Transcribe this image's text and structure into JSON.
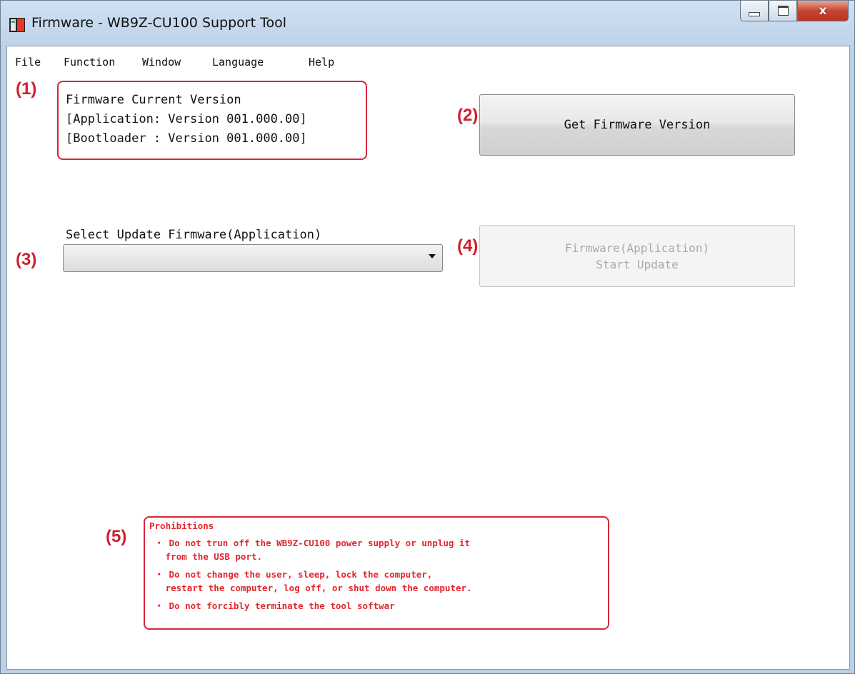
{
  "window": {
    "title": "Firmware - WB9Z-CU100 Support Tool",
    "close_glyph": "x",
    "colors": {
      "callout": "#d0202f",
      "prohibition_text": "#e2262e"
    }
  },
  "menu": [
    "File",
    "Function",
    "Window",
    "Language",
    "Help"
  ],
  "callouts": [
    "(1)",
    "(2)",
    "(3)",
    "(4)",
    "(5)"
  ],
  "firmware_info": {
    "heading": "Firmware Current Version",
    "application": "[Application: Version 001.000.00]",
    "bootloader": "[Bootloader : Version 001.000.00]"
  },
  "get_version_button": "Get Firmware Version",
  "select_update": {
    "label": "Select Update Firmware(Application)",
    "value": ""
  },
  "start_update_button": {
    "line1": "Firmware(Application)",
    "line2": "Start Update",
    "enabled": false
  },
  "prohibitions": {
    "title": "Prohibitions",
    "lines": [
      " ・ Do not trun off the WB9Z-CU100 power supply or unplug it",
      "   from the USB port.",
      " ・ Do not change the user, sleep, lock the computer,",
      "   restart the computer, log off, or shut down the computer.",
      " ・ Do not forcibly terminate the tool softwar"
    ]
  }
}
